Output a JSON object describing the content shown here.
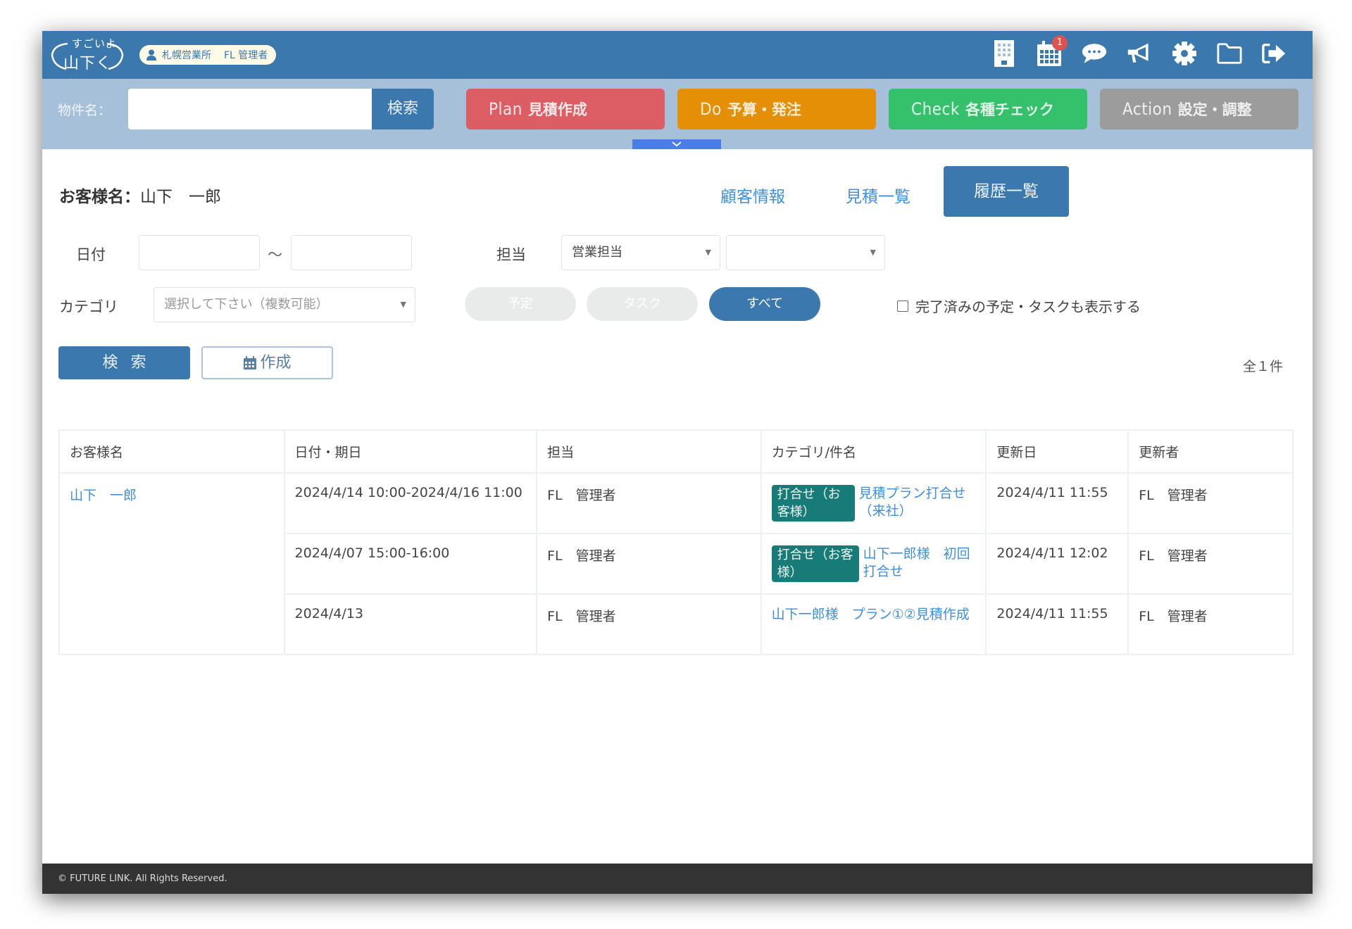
{
  "header": {
    "logo_line1": "すごいよ",
    "logo_line2": "山下くん",
    "user_office": "札幌営業所",
    "user_role": "FL 管理者",
    "icons": [
      "building-icon",
      "calendar-icon",
      "chat-icon",
      "megaphone-icon",
      "gear-icon",
      "folder-icon",
      "logout-icon"
    ],
    "calendar_badge": "1"
  },
  "toolbar": {
    "property_label": "物件名：",
    "property_value": "",
    "search_label": "検索",
    "pdca": [
      {
        "en": "Plan",
        "jp": "見積作成",
        "color": "#dc5d63"
      },
      {
        "en": "Do",
        "jp": "予算・発注",
        "color": "#e48f06"
      },
      {
        "en": "Check",
        "jp": "各種チェック",
        "color": "#35c16b"
      },
      {
        "en": "Action",
        "jp": "設定・調整",
        "color": "#9c9c9c"
      }
    ]
  },
  "customer": {
    "label": "お客様名：",
    "name": "山下　一郎"
  },
  "nav": {
    "customer_info": "顧客情報",
    "estimate_list": "見積一覧",
    "history_list": "履歴一覧"
  },
  "filters": {
    "date_label": "日付",
    "date_from": "",
    "date_to": "",
    "tilde": "～",
    "staff_label": "担当",
    "staff_type": "営業担当",
    "staff_person": "",
    "category_label": "カテゴリ",
    "category_placeholder": "選択して下さい（複数可能）",
    "type_buttons": [
      "予定",
      "タスク",
      "すべて"
    ],
    "type_selected": "すべて",
    "show_completed_label": "完了済みの予定・タスクも表示する",
    "show_completed": false
  },
  "actions": {
    "search": "検索",
    "create": "作成",
    "count": "全１件"
  },
  "table": {
    "headers": [
      "お客様名",
      "日付・期日",
      "担当",
      "カテゴリ/件名",
      "更新日",
      "更新者"
    ],
    "customer": "山下　一郎",
    "rows": [
      {
        "date": "2024/4/14 10:00-2024/4/16 11:00",
        "staff": "FL　管理者",
        "category": "打合せ（お客様）",
        "title": "見積プラン打合せ（来社）",
        "updated": "2024/4/11 11:55",
        "updater": "FL　管理者"
      },
      {
        "date": "2024/4/07 15:00-16:00",
        "staff": "FL　管理者",
        "category": "打合せ（お客様）",
        "title": "山下一郎様　初回打合せ",
        "updated": "2024/4/11 12:02",
        "updater": "FL　管理者"
      },
      {
        "date": "2024/4/13",
        "staff": "FL　管理者",
        "category": "",
        "title": "山下一郎様　プラン①②見積作成",
        "updated": "2024/4/11 11:55",
        "updater": "FL　管理者"
      }
    ]
  },
  "footer": {
    "copyright": "© FUTURE LINK. All Rights Reserved."
  }
}
